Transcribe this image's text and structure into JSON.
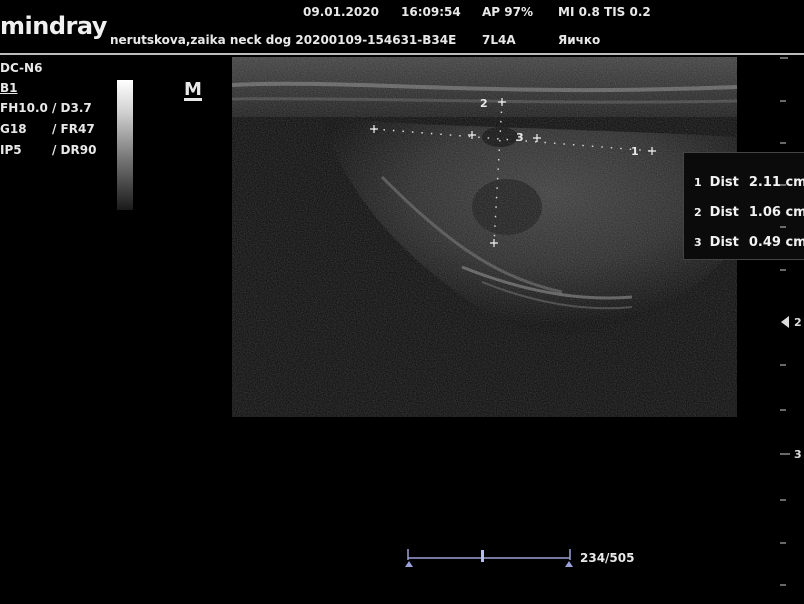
{
  "header": {
    "logo": "mindray",
    "date": "09.01.2020",
    "time": "16:09:54",
    "ap": "AP  97%",
    "mi_tis": "MI 0.8 TIS 0.2",
    "patient": "nerutskova,zaika neck dog 20200109-154631-B34E",
    "probe": "7L4A",
    "preset": "Яичко"
  },
  "sidebar": {
    "mode": "DC-N6",
    "b_mode": "B1",
    "params": [
      {
        "left": "FH10.0",
        "right": "/ D3.7"
      },
      {
        "left": "G18",
        "right": "/ FR47"
      },
      {
        "left": "IP5",
        "right": "/ DR90"
      }
    ]
  },
  "marker_m": "M",
  "calipers": {
    "c1": "1",
    "c2": "2",
    "c3": "3"
  },
  "measurements": [
    {
      "num": "1",
      "label": "Dist",
      "value": "2.11 cm"
    },
    {
      "num": "2",
      "label": "Dist",
      "value": "1.06 cm"
    },
    {
      "num": "3",
      "label": "Dist",
      "value": "0.49 cm"
    }
  ],
  "cine": {
    "frame": "234/505",
    "position": 0.46
  },
  "depth_ruler": {
    "mark_2": "2",
    "mark_3": "3"
  }
}
